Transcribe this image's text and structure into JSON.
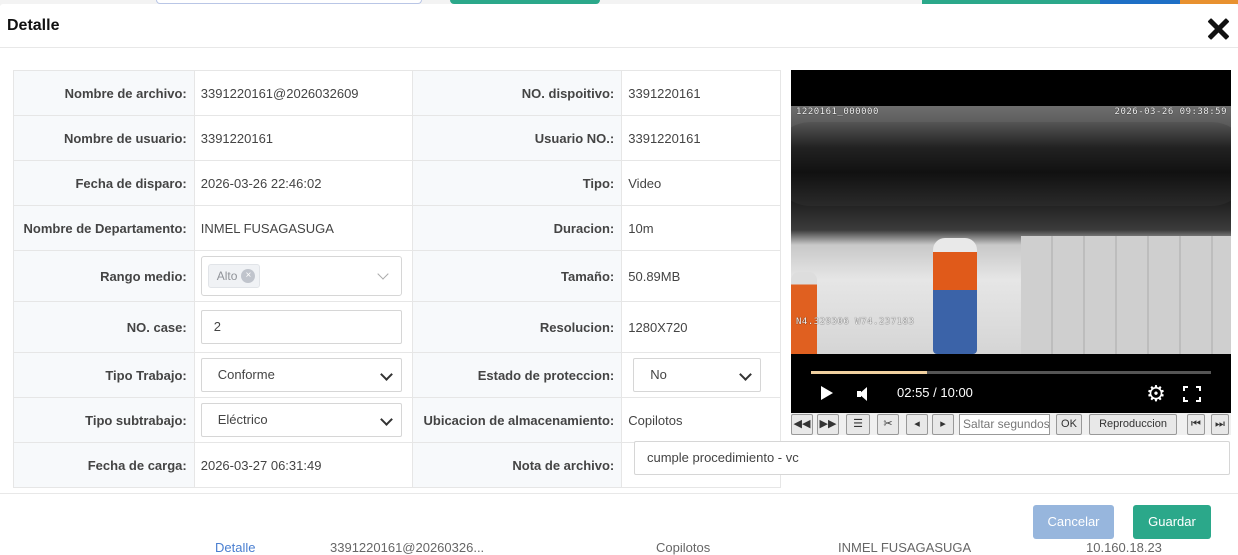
{
  "modal": {
    "title": "Detalle",
    "close_icon": "close-icon"
  },
  "fields": {
    "file_name": {
      "label": "Nombre de archivo:",
      "value": "3391220161@2026032609"
    },
    "device_no": {
      "label": "NO. dispoitivo:",
      "value": "3391220161"
    },
    "user_name": {
      "label": "Nombre de usuario:",
      "value": "3391220161"
    },
    "user_no": {
      "label": "Usuario NO.:",
      "value": "3391220161"
    },
    "trigger_date": {
      "label": "Fecha de disparo:",
      "value": "2026-03-26 22:46:02"
    },
    "type": {
      "label": "Tipo:",
      "value": "Video"
    },
    "department": {
      "label": "Nombre de Departamento:",
      "value": "INMEL FUSAGASUGA"
    },
    "duration": {
      "label": "Duracion:",
      "value": "10m"
    },
    "media_range": {
      "label": "Rango medio:",
      "tag": "Alto"
    },
    "size": {
      "label": "Tamaño:",
      "value": "50.89MB"
    },
    "case_no": {
      "label": "NO. case:",
      "value": "2"
    },
    "resolution": {
      "label": "Resolucion:",
      "value": "1280X720"
    },
    "work_type": {
      "label": "Tipo Trabajo:",
      "value": "Conforme"
    },
    "protection": {
      "label": "Estado de proteccion:",
      "value": "No"
    },
    "work_subtype": {
      "label": "Tipo subtrabajo:",
      "value": "Eléctrico"
    },
    "storage": {
      "label": "Ubicacion de almacenamiento:",
      "value": "Copilotos"
    },
    "upload_date": {
      "label": "Fecha de carga:",
      "value": "2026-03-27 06:31:49"
    },
    "file_note": {
      "label": "Nota de archivo:",
      "value": "cumple procedimiento - vc"
    }
  },
  "video": {
    "overlay_left": "1220161_000000",
    "overlay_right": "2026-03-26 09:38:59",
    "overlay_coords": "N4.329306 W74.237183",
    "time": "02:55 / 10:00",
    "progress": 0.29
  },
  "toolbar": {
    "seek_placeholder": "Saltar segundos",
    "ok_label": "OK",
    "playback_label": "Reproduccion"
  },
  "footer": {
    "cancel_label": "Cancelar",
    "save_label": "Guardar"
  },
  "colors": {
    "save": "#2ba88a",
    "cancel": "#97b6dd"
  },
  "background": {
    "row_link": "Detalle",
    "row_file": "3391220161@20260326...",
    "row_storage": "Copilotos",
    "row_dept": "INMEL FUSAGASUGA",
    "row_ip": "10.160.18.23"
  }
}
